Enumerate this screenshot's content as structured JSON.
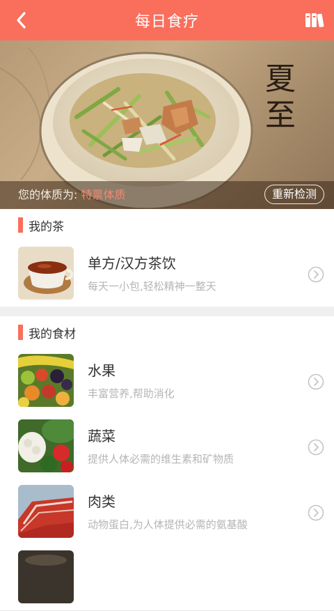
{
  "header": {
    "title": "每日食疗",
    "back_icon": "chevron-left-icon",
    "books_icon": "books-icon",
    "bg_color": "#fa6e5c"
  },
  "banner": {
    "calligraphy_line1": "夏",
    "calligraphy_line2": "至",
    "constitution_label": "您的体质为:",
    "constitution_value": "特禀体质",
    "retest_label": "重新检测"
  },
  "tea_section": {
    "title": "我的茶",
    "items": [
      {
        "name": "单方/汉方茶饮",
        "desc": "每天一小包,轻松精神一整天",
        "icon": "tea-icon"
      }
    ]
  },
  "food_section": {
    "title": "我的食材",
    "items": [
      {
        "name": "水果",
        "desc": "丰富营养,帮助消化",
        "icon": "fruit-icon"
      },
      {
        "name": "蔬菜",
        "desc": "提供人体必需的维生素和矿物质",
        "icon": "vegetable-icon"
      },
      {
        "name": "肉类",
        "desc": "动物蛋白,为人体提供必需的氨基酸",
        "icon": "meat-icon"
      }
    ]
  },
  "colors": {
    "accent": "#fa6e5c",
    "muted_text": "#b5b5b5"
  }
}
